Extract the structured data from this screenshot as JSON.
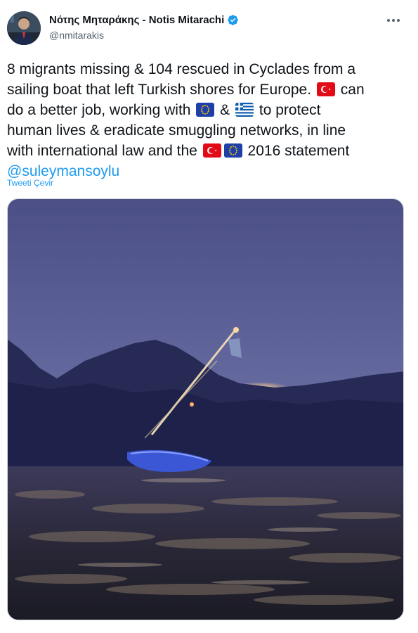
{
  "author": {
    "display_name": "Νότης Μηταράκης - Notis Mitarachi",
    "handle": "@nmitarakis",
    "verified": true,
    "avatar_icon": "person-avatar-icon"
  },
  "tweet": {
    "line1": "8 migrants missing & 104 rescued in Cyclades from a",
    "line2_a": "sailing boat that left Turkish shores for Europe.",
    "line2_b": "can",
    "line3_a": "do a better job, working with",
    "line3_b": "&",
    "line3_c": "to protect",
    "line4": "human lives & eradicate smuggling networks, in line",
    "line5_a": "with international law and the",
    "line5_b": "2016  statement",
    "mention": "@suleymansoylu"
  },
  "translate_label": "Tweeti Çevir",
  "more_icon": "more-options-icon",
  "flags": [
    "turkey-flag-icon",
    "eu-flag-icon",
    "greece-flag-icon"
  ],
  "colors": {
    "link": "#1d9bf0",
    "secondary_text": "#536471",
    "verified_badge": "#1d9bf0"
  }
}
